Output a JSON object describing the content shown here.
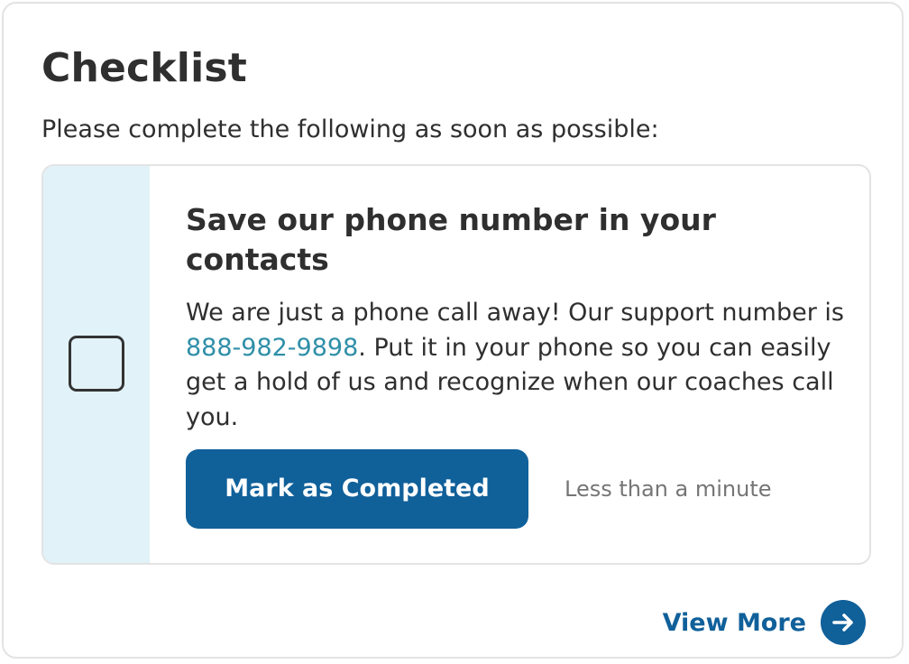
{
  "checklist": {
    "title": "Checklist",
    "subtitle": "Please complete the following as soon as possible:",
    "items": [
      {
        "title": "Save our phone number in your contacts",
        "description_before": "We are just a phone call away! Our support number is ",
        "phone": "888-982-9898",
        "description_after": ". Put it in your phone so you can easily get a hold of us and recognize when our coaches call you.",
        "completed": false,
        "button_label": "Mark as Completed",
        "duration": "Less than a minute"
      }
    ],
    "view_more_label": "View More"
  },
  "icons": {
    "checkbox": "checkbox-unchecked-icon",
    "view_more": "arrow-right-circle-icon"
  },
  "colors": {
    "primary": "#10609a",
    "link": "#2f8fa8",
    "rail": "#e1f2f9",
    "text": "#2f2f2f",
    "muted": "#757575",
    "border": "#e3e3e3"
  }
}
